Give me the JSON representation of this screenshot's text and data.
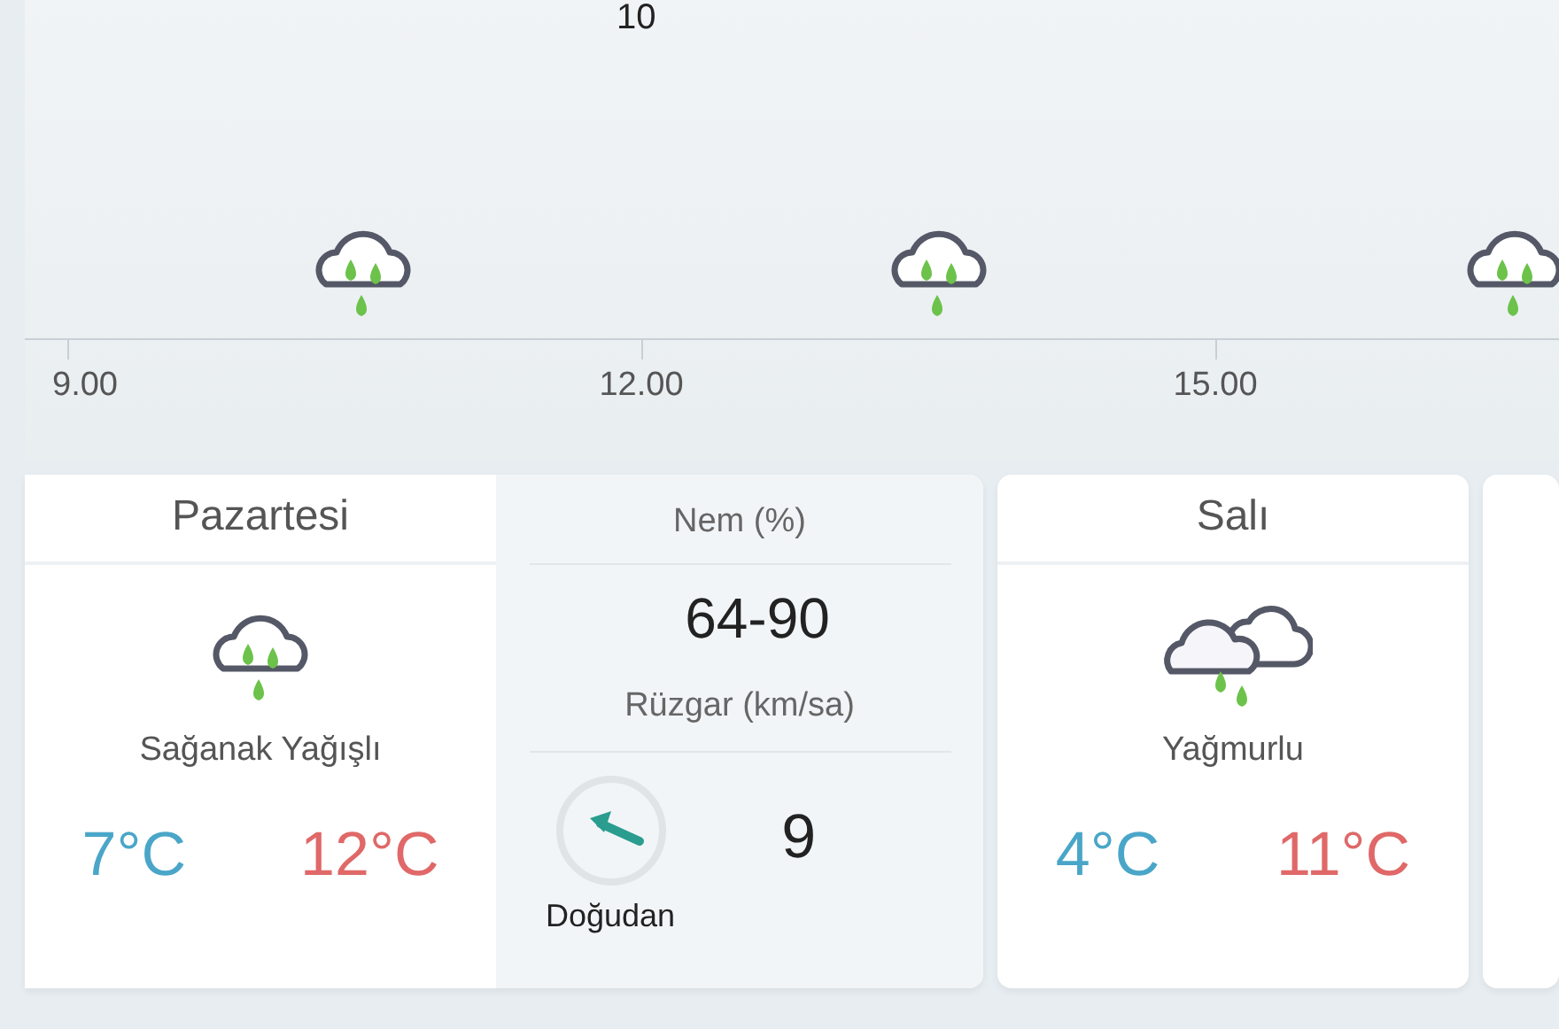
{
  "timeline": {
    "top_label": "10",
    "ticks": [
      "9.00",
      "12.00",
      "15.00"
    ],
    "icons": [
      {
        "kind": "showers"
      },
      {
        "kind": "showers"
      },
      {
        "kind": "showers"
      }
    ]
  },
  "days": [
    {
      "kind": "showers",
      "name": "Pazartesi",
      "description": "Sağanak Yağışlı",
      "low": "7°C",
      "high": "12°C",
      "details": {
        "humidity_label": "Nem (%)",
        "humidity": "64-90",
        "wind_label": "Rüzgar (km/sa)",
        "wind_direction": "Doğudan",
        "wind_speed": "9"
      }
    },
    {
      "kind": "rain",
      "name": "Salı",
      "description": "Yağmurlu",
      "low": "4°C",
      "high": "11°C"
    },
    {
      "kind": "empty"
    }
  ]
}
